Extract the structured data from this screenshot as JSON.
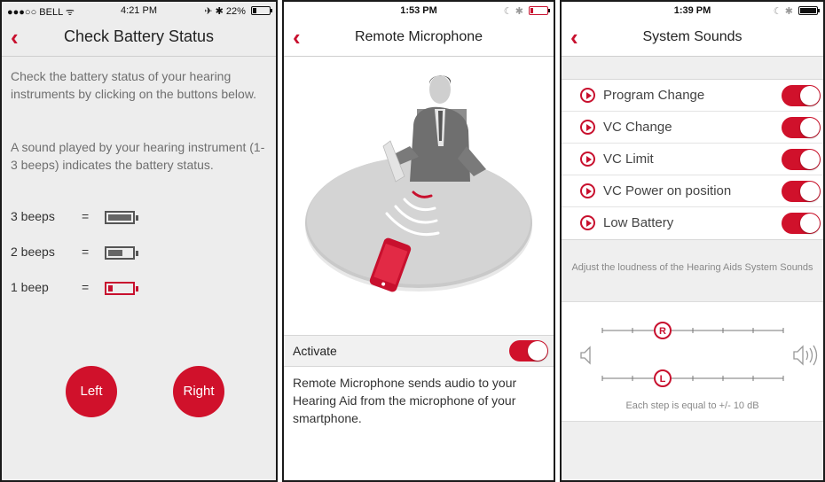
{
  "panel1": {
    "status": {
      "carrier": "●●●○○ BELL",
      "wifi_icon": "wifi-icon",
      "time": "4:21 PM",
      "right": "✈ ✱ 22%",
      "battery_level": 0.22
    },
    "nav": {
      "back_icon": "chevron-left-icon",
      "title": "Check Battery Status"
    },
    "intro_text": "Check the battery status of your hearing instruments by clicking on the buttons below.",
    "sound_text": "A sound played by your hearing instrument (1-3 beeps) indicates the battery status.",
    "legend": [
      {
        "label": "3 beeps",
        "eq": "=",
        "level": 1.0,
        "color": "#666666"
      },
      {
        "label": "2 beeps",
        "eq": "=",
        "level": 0.6,
        "color": "#666666"
      },
      {
        "label": "1 beep",
        "eq": "=",
        "level": 0.2,
        "color": "#c8102e"
      }
    ],
    "buttons": {
      "left": "Left",
      "right": "Right"
    }
  },
  "panel2": {
    "status": {
      "time": "1:53 PM",
      "right": "☾ ✱",
      "battery_level": 0.15
    },
    "nav": {
      "back_icon": "chevron-left-icon",
      "title": "Remote Microphone"
    },
    "illustration": "remote-microphone-illustration",
    "activate": {
      "label": "Activate",
      "on": true
    },
    "description": "Remote Microphone sends audio to your Hearing Aid from the microphone of your smartphone."
  },
  "panel3": {
    "status": {
      "time": "1:39 PM",
      "right": "☾ ✱",
      "battery_level": 1.0
    },
    "nav": {
      "back_icon": "chevron-left-icon",
      "title": "System Sounds"
    },
    "sounds": [
      {
        "label": "Program Change",
        "on": true
      },
      {
        "label": "VC Change",
        "on": true
      },
      {
        "label": "VC Limit",
        "on": true
      },
      {
        "label": "VC Power on position",
        "on": true
      },
      {
        "label": "Low Battery",
        "on": true
      }
    ],
    "adjust_text": "Adjust the loudness of the Hearing Aids System Sounds",
    "sliders": [
      {
        "label": "R",
        "steps": 6,
        "position": 2
      },
      {
        "label": "L",
        "steps": 6,
        "position": 2
      }
    ],
    "step_text": "Each step is equal to +/- 10 dB",
    "colors": {
      "accent": "#c8102e"
    }
  }
}
